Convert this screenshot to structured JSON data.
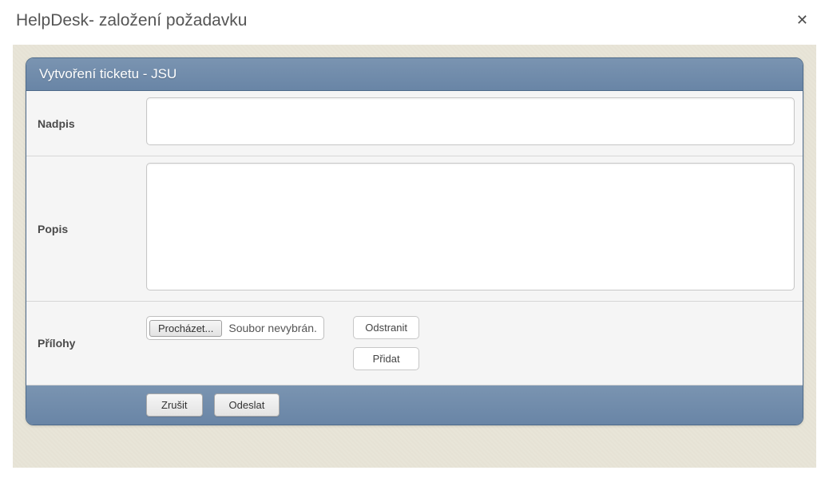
{
  "modal": {
    "title": "HelpDesk- založení požadavku"
  },
  "panel": {
    "title": "Vytvoření ticketu - JSU"
  },
  "form": {
    "subject_label": "Nadpis",
    "subject_value": "",
    "description_label": "Popis",
    "description_value": "",
    "attachments_label": "Přílohy",
    "browse_label": "Procházet...",
    "file_status": "Soubor nevybrán.",
    "remove_label": "Odstranit",
    "add_label": "Přidat"
  },
  "footer": {
    "cancel_label": "Zrušit",
    "submit_label": "Odeslat"
  }
}
